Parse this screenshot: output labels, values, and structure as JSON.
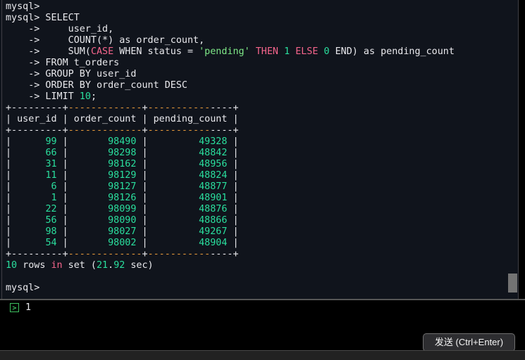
{
  "palette": {
    "termBg": "#10141c",
    "fg": "#e9e9ed",
    "pink": "#f5658c",
    "strGreen": "#7ee787",
    "numGreen": "#2adf9e",
    "orange": "#e3973a",
    "paneLine": "#3f3f46",
    "sep": "#565656",
    "thumb": "#737373",
    "promptGreen": "#3dbf5f",
    "btnBg": "#2d2d30",
    "btnBorder": "#6f6f6f",
    "btnFg": "#f5f5f5",
    "barBg": "#222222",
    "barBorder": "#484848"
  },
  "terminal": {
    "lines": [
      [
        {
          "t": "mysql>",
          "c": "w"
        }
      ],
      [
        {
          "t": "mysql> SELECT",
          "c": "w"
        }
      ],
      [
        {
          "t": "    ->     user_id,",
          "c": "w"
        }
      ],
      [
        {
          "t": "    ->     COUNT(*) as order_count,",
          "c": "w"
        }
      ],
      [
        {
          "t": "    ->     SUM(",
          "c": "w"
        },
        {
          "t": "CASE",
          "c": "p"
        },
        {
          "t": " WHEN status = ",
          "c": "w"
        },
        {
          "t": "'pending'",
          "c": "s"
        },
        {
          "t": " ",
          "c": "w"
        },
        {
          "t": "THEN",
          "c": "p"
        },
        {
          "t": " ",
          "c": "w"
        },
        {
          "t": "1",
          "c": "n"
        },
        {
          "t": " ",
          "c": "w"
        },
        {
          "t": "ELSE",
          "c": "p"
        },
        {
          "t": " ",
          "c": "w"
        },
        {
          "t": "0",
          "c": "n"
        },
        {
          "t": " END) as pending_count",
          "c": "w"
        }
      ],
      [
        {
          "t": "    -> FROM t_orders",
          "c": "w"
        }
      ],
      [
        {
          "t": "    -> GROUP BY user_id",
          "c": "w"
        }
      ],
      [
        {
          "t": "    -> ORDER BY order_count DESC",
          "c": "w"
        }
      ],
      [
        {
          "t": "    -> LIMIT ",
          "c": "w"
        },
        {
          "t": "10",
          "c": "n"
        },
        {
          "t": ";",
          "c": "w"
        }
      ],
      [
        {
          "t": "+---------+",
          "c": "w"
        },
        {
          "t": "-------------",
          "c": "o"
        },
        {
          "t": "+",
          "c": "w"
        },
        {
          "t": "-----------",
          "c": "o"
        },
        {
          "t": "----+",
          "c": "w"
        }
      ],
      [
        {
          "t": "| user_id | order_count | pending_count |",
          "c": "w"
        }
      ],
      [
        {
          "t": "+---------+",
          "c": "w"
        },
        {
          "t": "-------------",
          "c": "o"
        },
        {
          "t": "+",
          "c": "w"
        },
        {
          "t": "-----------",
          "c": "o"
        },
        {
          "t": "----+",
          "c": "w"
        }
      ],
      [
        {
          "t": "|      ",
          "c": "w"
        },
        {
          "t": "99",
          "c": "n"
        },
        {
          "t": " |       ",
          "c": "w"
        },
        {
          "t": "98490",
          "c": "n"
        },
        {
          "t": " |         ",
          "c": "w"
        },
        {
          "t": "49328",
          "c": "n"
        },
        {
          "t": " |",
          "c": "w"
        }
      ],
      [
        {
          "t": "|      ",
          "c": "w"
        },
        {
          "t": "66",
          "c": "n"
        },
        {
          "t": " |       ",
          "c": "w"
        },
        {
          "t": "98298",
          "c": "n"
        },
        {
          "t": " |         ",
          "c": "w"
        },
        {
          "t": "48842",
          "c": "n"
        },
        {
          "t": " |",
          "c": "w"
        }
      ],
      [
        {
          "t": "|      ",
          "c": "w"
        },
        {
          "t": "31",
          "c": "n"
        },
        {
          "t": " |       ",
          "c": "w"
        },
        {
          "t": "98162",
          "c": "n"
        },
        {
          "t": " |         ",
          "c": "w"
        },
        {
          "t": "48956",
          "c": "n"
        },
        {
          "t": " |",
          "c": "w"
        }
      ],
      [
        {
          "t": "|      ",
          "c": "w"
        },
        {
          "t": "11",
          "c": "n"
        },
        {
          "t": " |       ",
          "c": "w"
        },
        {
          "t": "98129",
          "c": "n"
        },
        {
          "t": " |         ",
          "c": "w"
        },
        {
          "t": "48824",
          "c": "n"
        },
        {
          "t": " |",
          "c": "w"
        }
      ],
      [
        {
          "t": "|       ",
          "c": "w"
        },
        {
          "t": "6",
          "c": "n"
        },
        {
          "t": " |       ",
          "c": "w"
        },
        {
          "t": "98127",
          "c": "n"
        },
        {
          "t": " |         ",
          "c": "w"
        },
        {
          "t": "48877",
          "c": "n"
        },
        {
          "t": " |",
          "c": "w"
        }
      ],
      [
        {
          "t": "|       ",
          "c": "w"
        },
        {
          "t": "1",
          "c": "n"
        },
        {
          "t": " |       ",
          "c": "w"
        },
        {
          "t": "98126",
          "c": "n"
        },
        {
          "t": " |         ",
          "c": "w"
        },
        {
          "t": "48901",
          "c": "n"
        },
        {
          "t": " |",
          "c": "w"
        }
      ],
      [
        {
          "t": "|      ",
          "c": "w"
        },
        {
          "t": "22",
          "c": "n"
        },
        {
          "t": " |       ",
          "c": "w"
        },
        {
          "t": "98099",
          "c": "n"
        },
        {
          "t": " |         ",
          "c": "w"
        },
        {
          "t": "48876",
          "c": "n"
        },
        {
          "t": " |",
          "c": "w"
        }
      ],
      [
        {
          "t": "|      ",
          "c": "w"
        },
        {
          "t": "56",
          "c": "n"
        },
        {
          "t": " |       ",
          "c": "w"
        },
        {
          "t": "98090",
          "c": "n"
        },
        {
          "t": " |         ",
          "c": "w"
        },
        {
          "t": "48866",
          "c": "n"
        },
        {
          "t": " |",
          "c": "w"
        }
      ],
      [
        {
          "t": "|      ",
          "c": "w"
        },
        {
          "t": "98",
          "c": "n"
        },
        {
          "t": " |       ",
          "c": "w"
        },
        {
          "t": "98027",
          "c": "n"
        },
        {
          "t": " |         ",
          "c": "w"
        },
        {
          "t": "49267",
          "c": "n"
        },
        {
          "t": " |",
          "c": "w"
        }
      ],
      [
        {
          "t": "|      ",
          "c": "w"
        },
        {
          "t": "54",
          "c": "n"
        },
        {
          "t": " |       ",
          "c": "w"
        },
        {
          "t": "98002",
          "c": "n"
        },
        {
          "t": " |         ",
          "c": "w"
        },
        {
          "t": "48904",
          "c": "n"
        },
        {
          "t": " |",
          "c": "w"
        }
      ],
      [
        {
          "t": "+---------+",
          "c": "w"
        },
        {
          "t": "-------------",
          "c": "o"
        },
        {
          "t": "+",
          "c": "w"
        },
        {
          "t": "-----------",
          "c": "o"
        },
        {
          "t": "----+",
          "c": "w"
        }
      ],
      [
        {
          "t": "10",
          "c": "n"
        },
        {
          "t": " rows ",
          "c": "w"
        },
        {
          "t": "in",
          "c": "p"
        },
        {
          "t": " set (",
          "c": "w"
        },
        {
          "t": "21",
          "c": "n"
        },
        {
          "t": ".",
          "c": "w"
        },
        {
          "t": "92",
          "c": "n"
        },
        {
          "t": " sec)",
          "c": "w"
        }
      ],
      [],
      [
        {
          "t": "mysql>",
          "c": "w"
        }
      ]
    ],
    "status_line": "10 rows in set (21.92 sec)",
    "prompt": "mysql>"
  },
  "result_table": {
    "columns": [
      "user_id",
      "order_count",
      "pending_count"
    ],
    "rows": [
      [
        99,
        98490,
        49328
      ],
      [
        66,
        98298,
        48842
      ],
      [
        31,
        98162,
        48956
      ],
      [
        11,
        98129,
        48824
      ],
      [
        6,
        98127,
        48877
      ],
      [
        1,
        98126,
        48901
      ],
      [
        22,
        98099,
        48876
      ],
      [
        56,
        98090,
        48866
      ],
      [
        98,
        98027,
        49267
      ],
      [
        54,
        98002,
        48904
      ]
    ]
  },
  "query": "SELECT user_id, COUNT(*) as order_count, SUM(CASE WHEN status = 'pending' THEN 1 ELSE 0 END) as pending_count FROM t_orders GROUP BY user_id ORDER BY order_count DESC LIMIT 10;",
  "input": {
    "prompt_icon": "run-prompt-icon",
    "prompt_icon_glyph": ">",
    "value": "1"
  },
  "send_button": {
    "label": "发送 (Ctrl+Enter)"
  }
}
